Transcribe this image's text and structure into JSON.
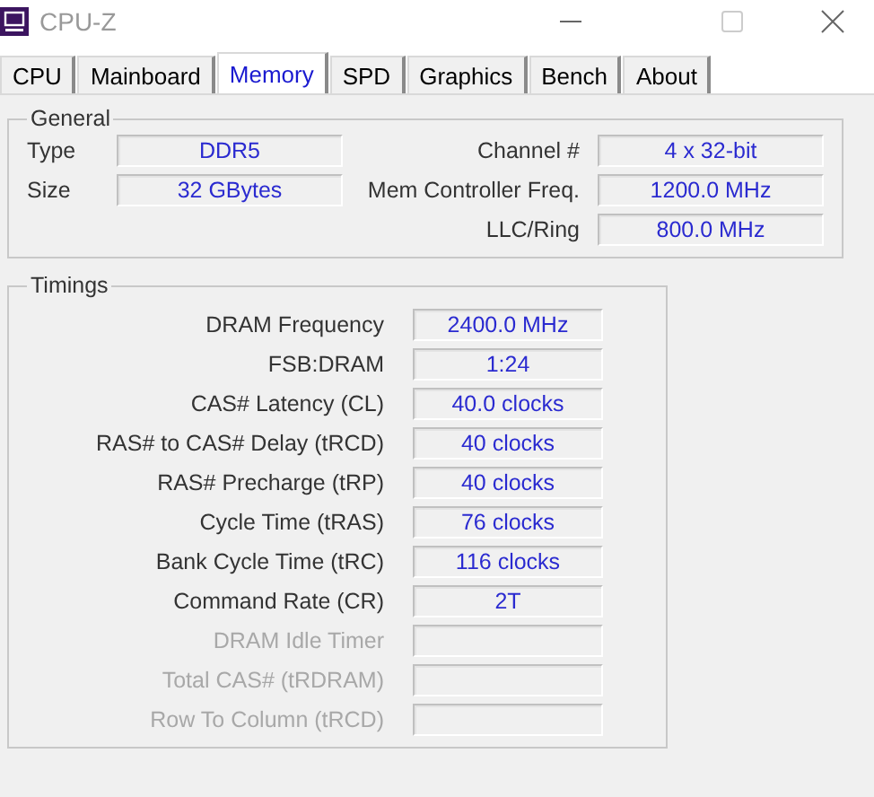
{
  "window": {
    "title": "CPU-Z"
  },
  "tabs": [
    {
      "label": "CPU",
      "selected": false
    },
    {
      "label": "Mainboard",
      "selected": false
    },
    {
      "label": "Memory",
      "selected": true
    },
    {
      "label": "SPD",
      "selected": false
    },
    {
      "label": "Graphics",
      "selected": false
    },
    {
      "label": "Bench",
      "selected": false
    },
    {
      "label": "About",
      "selected": false
    }
  ],
  "general": {
    "title": "General",
    "left": [
      {
        "label": "Type",
        "value": "DDR5"
      },
      {
        "label": "Size",
        "value": "32 GBytes"
      }
    ],
    "right": [
      {
        "label": "Channel #",
        "value": "4 x 32-bit"
      },
      {
        "label": "Mem Controller Freq.",
        "value": "1200.0 MHz"
      },
      {
        "label": "LLC/Ring",
        "value": "800.0 MHz"
      }
    ]
  },
  "timings": {
    "title": "Timings",
    "rows": [
      {
        "label": "DRAM Frequency",
        "value": "2400.0 MHz",
        "disabled": false
      },
      {
        "label": "FSB:DRAM",
        "value": "1:24",
        "disabled": false
      },
      {
        "label": "CAS# Latency (CL)",
        "value": "40.0 clocks",
        "disabled": false
      },
      {
        "label": "RAS# to CAS# Delay (tRCD)",
        "value": "40 clocks",
        "disabled": false
      },
      {
        "label": "RAS# Precharge (tRP)",
        "value": "40 clocks",
        "disabled": false
      },
      {
        "label": "Cycle Time (tRAS)",
        "value": "76 clocks",
        "disabled": false
      },
      {
        "label": "Bank Cycle Time (tRC)",
        "value": "116 clocks",
        "disabled": false
      },
      {
        "label": "Command Rate (CR)",
        "value": "2T",
        "disabled": false
      },
      {
        "label": "DRAM Idle Timer",
        "disabled": true
      },
      {
        "label": "Total CAS# (tRDRAM)",
        "disabled": true
      },
      {
        "label": "Row To Column (tRCD)",
        "disabled": true
      }
    ]
  }
}
